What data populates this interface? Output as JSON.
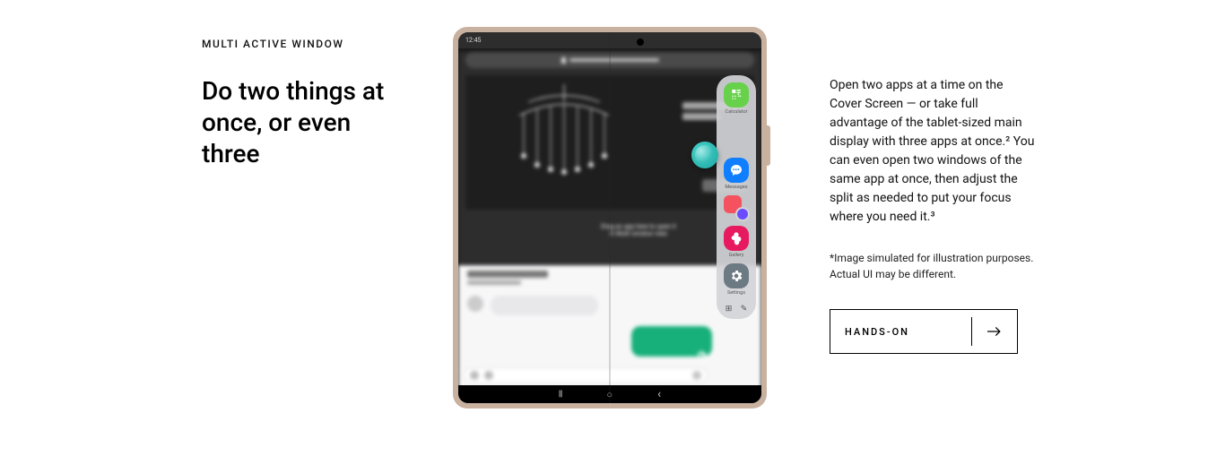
{
  "left": {
    "eyebrow": "MULTI ACTIVE WINDOW",
    "heading": "Do two things at once, or even three"
  },
  "device": {
    "statusbar_time": "12:45",
    "drag_hint_line1": "Drag an app here to open it",
    "drag_hint_line2": "in Multi window view",
    "nav_recent": "|||",
    "nav_home": "○",
    "nav_back": "‹"
  },
  "edge_panel": {
    "items": [
      {
        "label": "Calculator"
      },
      {
        "label": ""
      },
      {
        "label": "Messages"
      },
      {
        "label": ""
      },
      {
        "label": "Gallery"
      },
      {
        "label": "Settings"
      }
    ],
    "footer_grid": "⊞",
    "footer_edit": "✎"
  },
  "right": {
    "body": "Open two apps at a time on the Cover Screen — or take full advantage of the tablet-sized main display with three apps at once.² You can even open two windows of the same app at once, then adjust the split as needed to put your focus where you need it.³",
    "footnote": "*Image simulated for illustration purposes. Actual UI may be different.",
    "cta_label": "HANDS-ON"
  }
}
